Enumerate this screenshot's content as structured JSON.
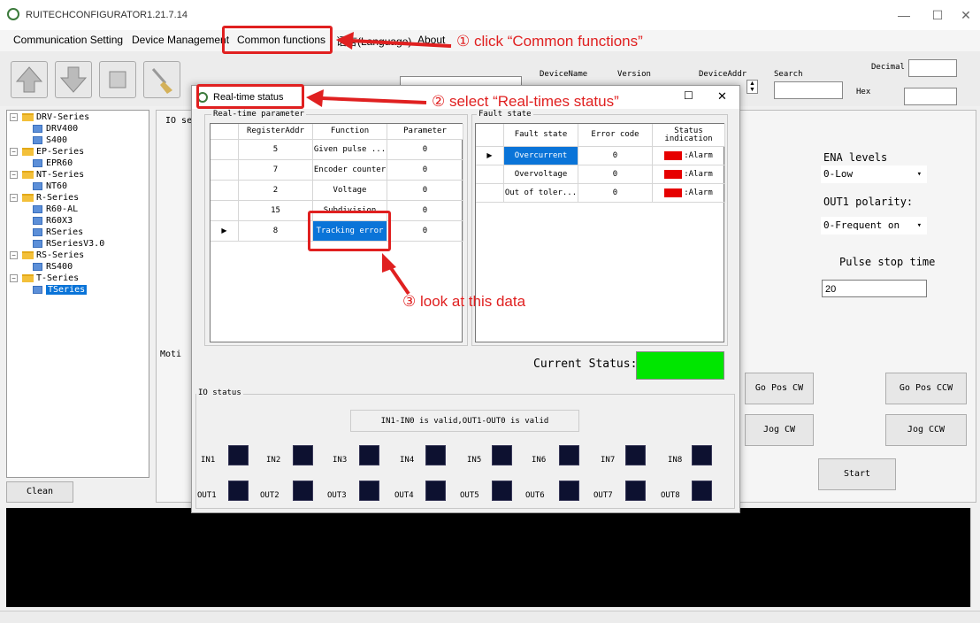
{
  "app": {
    "title": "RUITECHCONFIGURATOR1.21.7.14"
  },
  "menu": {
    "items": [
      "Communication Setting",
      "Device Management",
      "Common functions",
      "语言(Language)",
      "About"
    ]
  },
  "toolbar": {
    "device_name_label": "DeviceName",
    "version_label": "Version",
    "device_addr_label": "DeviceAddr",
    "search_label": "Search",
    "decimal_label": "Decimal",
    "hex_label": "Hex"
  },
  "tree": [
    {
      "label": "DRV-Series",
      "children": [
        "DRV400",
        "S400"
      ]
    },
    {
      "label": "EP-Series",
      "children": [
        "EPR60"
      ]
    },
    {
      "label": "NT-Series",
      "children": [
        "NT60"
      ]
    },
    {
      "label": "R-Series",
      "children": [
        "R60-AL",
        "R60X3",
        "RSeries",
        "RSeriesV3.0"
      ]
    },
    {
      "label": "RS-Series",
      "children": [
        "RS400"
      ]
    },
    {
      "label": "T-Series",
      "children": [
        "TSeries"
      ]
    }
  ],
  "tree_selected": "TSeries",
  "clean_button": "Clean",
  "main": {
    "io_section": "IO se",
    "motion_section": "Moti",
    "ena_levels_label": "ENA levels",
    "ena_levels_value": "0-Low",
    "out1_polarity_label": "OUT1 polarity:",
    "out1_polarity_value": "0-Frequent on",
    "pulse_stop_label": "Pulse stop time",
    "pulse_stop_value": "20",
    "buttons": {
      "go_pos_cw": "Go Pos CW",
      "go_pos_ccw": "Go Pos CCW",
      "jog_cw": "Jog CW",
      "jog_ccw": "Jog CCW",
      "start": "Start"
    }
  },
  "dialog": {
    "title": "Real-time status",
    "realtime_group": "Real-time parameter",
    "fault_group": "Fault state",
    "realtime_columns": [
      "RegisterAddr",
      "Function",
      "Parameter"
    ],
    "realtime_rows": [
      {
        "addr": "5",
        "function": "Given pulse ...",
        "param": "0"
      },
      {
        "addr": "7",
        "function": "Encoder counter",
        "param": "0"
      },
      {
        "addr": "2",
        "function": "Voltage",
        "param": "0"
      },
      {
        "addr": "15",
        "function": "Subdivision",
        "param": "0"
      },
      {
        "addr": "8",
        "function": "Tracking error",
        "param": "0"
      }
    ],
    "fault_columns": [
      "Fault state",
      "Error code",
      "Status indication"
    ],
    "fault_rows": [
      {
        "state": "Overcurrent",
        "code": "0",
        "status": ":Alarm"
      },
      {
        "state": "Overvoltage",
        "code": "0",
        "status": ":Alarm"
      },
      {
        "state": "Out of toler...",
        "code": "0",
        "status": ":Alarm"
      }
    ],
    "current_status_label": "Current Status:",
    "current_status_color": "#00e600",
    "io_status_group": "IO status",
    "io_note": "IN1-IN0 is valid,OUT1-OUT0 is valid",
    "inputs": [
      "IN1",
      "IN2",
      "IN3",
      "IN4",
      "IN5",
      "IN6",
      "IN7",
      "IN8"
    ],
    "outputs": [
      "OUT1",
      "OUT2",
      "OUT3",
      "OUT4",
      "OUT5",
      "OUT6",
      "OUT7",
      "OUT8"
    ]
  },
  "annotations": {
    "step1": "① click “Common functions”",
    "step2": "② select “Real-times status”",
    "step3": "③ look at this data",
    "color": "#e02020"
  }
}
